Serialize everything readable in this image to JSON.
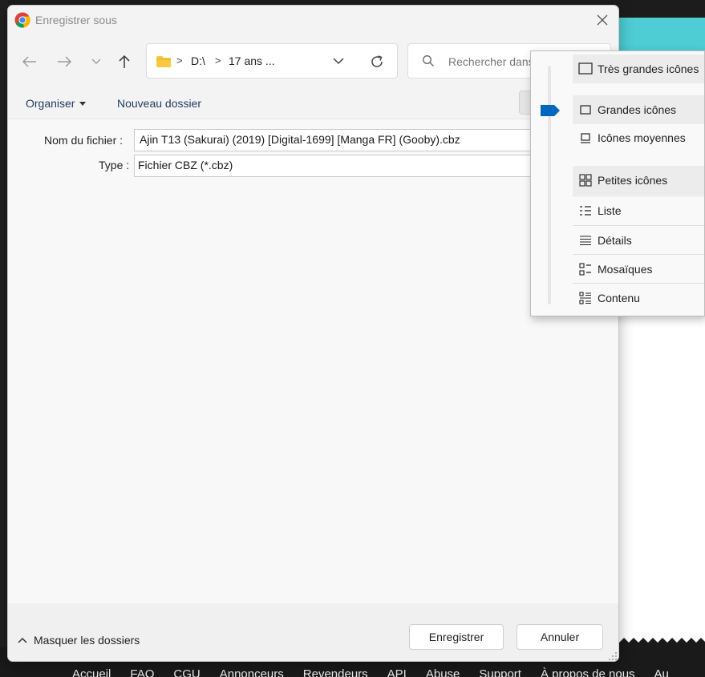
{
  "dialog": {
    "title": "Enregistrer sous"
  },
  "address": {
    "drive": "D:\\",
    "folder": "17 ans ..."
  },
  "search": {
    "placeholder": "Rechercher dans"
  },
  "toolbar": {
    "organize_label": "Organiser",
    "new_folder_label": "Nouveau dossier"
  },
  "form": {
    "filename_label": "Nom du fichier :",
    "filename_value": "Ajin T13 (Sakurai) (2019) [Digital-1699] [Manga FR] (Gooby).cbz",
    "type_label": "Type :",
    "type_value": "Fichier CBZ (*.cbz)"
  },
  "footer": {
    "hide_folders_label": "Masquer les dossiers",
    "save_label": "Enregistrer",
    "cancel_label": "Annuler"
  },
  "view_menu": {
    "items": [
      {
        "label": "Très grandes icônes",
        "icon": "extra-large-icons-icon"
      },
      {
        "label": "Grandes icônes",
        "icon": "large-icons-icon"
      },
      {
        "label": "Icônes moyennes",
        "icon": "medium-icons-icon"
      },
      {
        "label": "Petites icônes",
        "icon": "small-icons-icon"
      },
      {
        "label": "Liste",
        "icon": "list-icon"
      },
      {
        "label": "Détails",
        "icon": "details-icon"
      },
      {
        "label": "Mosaïques",
        "icon": "tiles-icon"
      },
      {
        "label": "Contenu",
        "icon": "content-icon"
      }
    ],
    "selected_index": 1
  },
  "background_page": {
    "footer_links": [
      "Accueil",
      "FAQ",
      "CGU",
      "Annonceurs",
      "Revendeurs",
      "API",
      "Abuse",
      "Support",
      "À propos de nous",
      "Au"
    ]
  },
  "colors": {
    "accent": "#0067c0",
    "teal": "#4ecdd4",
    "folder": "#f8c93e"
  }
}
